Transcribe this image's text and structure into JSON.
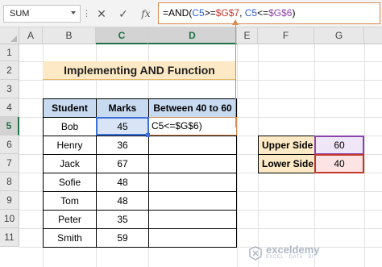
{
  "formula_bar": {
    "name_box": "SUM",
    "cancel_icon": "✕",
    "enter_icon": "✓",
    "fx_label": "fx",
    "formula_parts": [
      "=AND(",
      "C5",
      ">=",
      "$G$7",
      ", ",
      "C5",
      "<=",
      "$G$6",
      ")"
    ]
  },
  "columns": [
    "A",
    "B",
    "C",
    "D",
    "E",
    "F",
    "G"
  ],
  "rows": [
    "1",
    "2",
    "3",
    "4",
    "5",
    "6",
    "7",
    "8",
    "9",
    "10",
    "11"
  ],
  "sheet": {
    "title": "Implementing AND Function",
    "headers": [
      "Student",
      "Marks",
      "Between 40 to 60"
    ],
    "students": [
      {
        "name": "Bob",
        "marks": "45"
      },
      {
        "name": "Henry",
        "marks": "36"
      },
      {
        "name": "Jack",
        "marks": "67"
      },
      {
        "name": "Sofie",
        "marks": "48"
      },
      {
        "name": "Tom",
        "marks": "48"
      },
      {
        "name": "Peter",
        "marks": "35"
      },
      {
        "name": "Smith",
        "marks": "59"
      }
    ],
    "active_cell_text": "C5<=$G$6)",
    "upper_side_label": "Upper Side",
    "upper_side_value": "60",
    "lower_side_label": "Lower Side",
    "lower_side_value": "40"
  },
  "watermark": {
    "brand": "exceldemy",
    "tagline": "EXCEL · DATA · BI"
  },
  "colors": {
    "accent_orange": "#d88c52",
    "header_blue": "#c7daf0",
    "title_fill": "#fde9c5",
    "purple": "#8e44ad",
    "red": "#c0392b"
  }
}
